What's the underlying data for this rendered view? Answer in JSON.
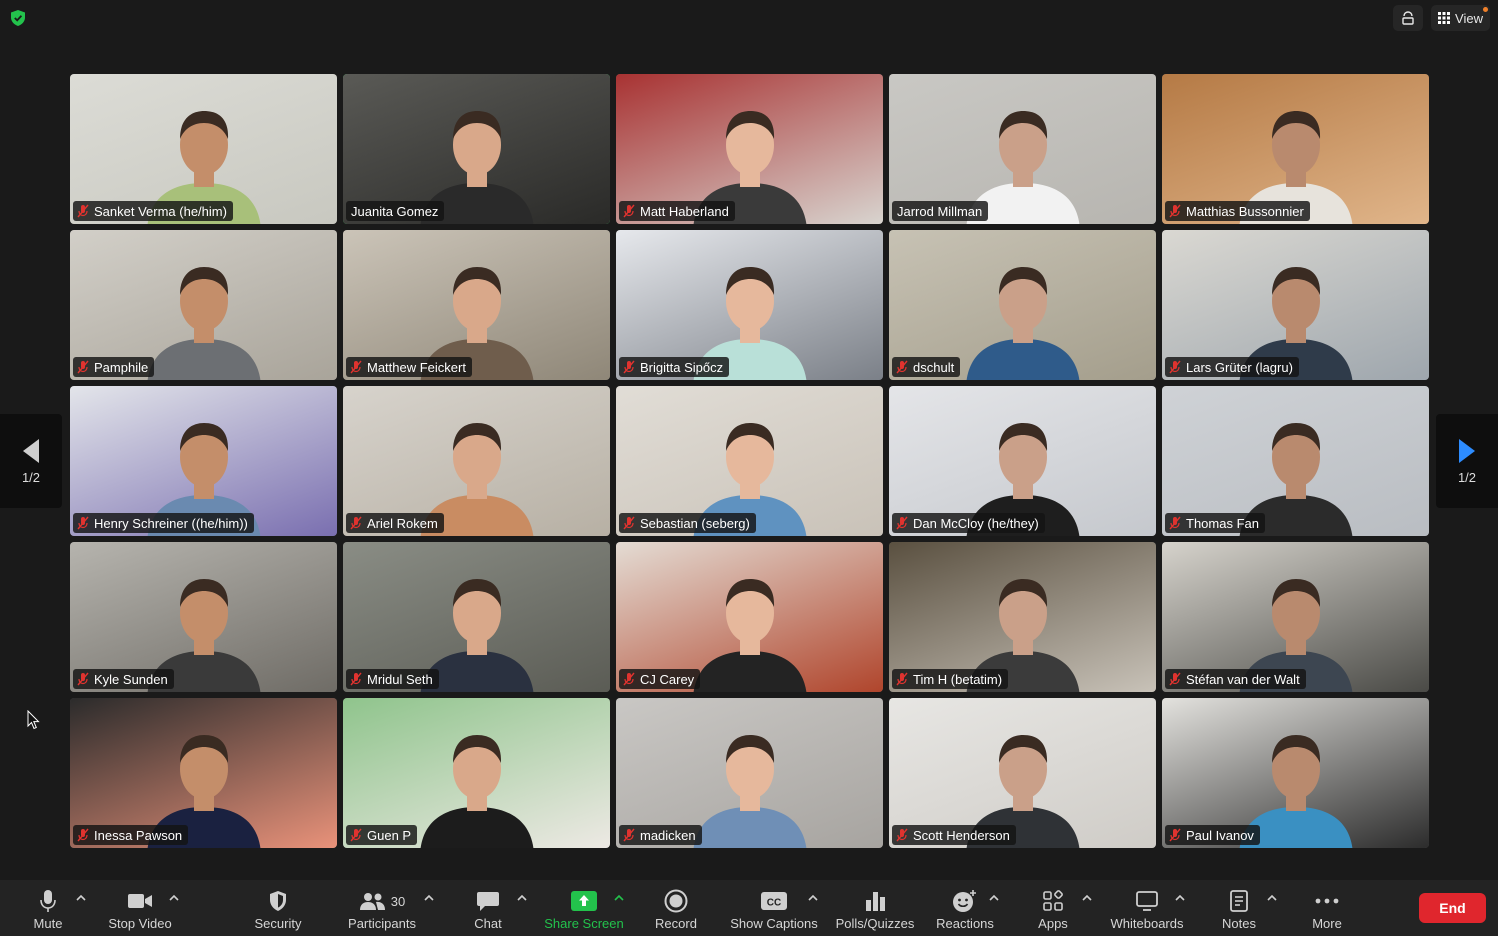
{
  "top": {
    "view_label": "View"
  },
  "colors": {
    "active_border": "#2fd05a",
    "share_green": "#23c24c",
    "end_red": "#e0262d",
    "mute_red": "#e0332f"
  },
  "pager": {
    "left_page": "1/2",
    "right_page": "1/2"
  },
  "participants": [
    {
      "name": "Sanket Verma (he/him)",
      "muted": true
    },
    {
      "name": "Juanita Gomez",
      "muted": false,
      "active": true
    },
    {
      "name": "Matt Haberland",
      "muted": true
    },
    {
      "name": "Jarrod Millman",
      "muted": false
    },
    {
      "name": "Matthias Bussonnier",
      "muted": true
    },
    {
      "name": "Pamphile",
      "muted": true
    },
    {
      "name": "Matthew Feickert",
      "muted": true
    },
    {
      "name": "Brigitta Sipőcz",
      "muted": true
    },
    {
      "name": "dschult",
      "muted": true
    },
    {
      "name": "Lars Grüter (lagru)",
      "muted": true
    },
    {
      "name": "Henry Schreiner ((he/him))",
      "muted": true
    },
    {
      "name": "Ariel Rokem",
      "muted": true
    },
    {
      "name": "Sebastian (seberg)",
      "muted": true
    },
    {
      "name": "Dan McCloy (he/they)",
      "muted": true
    },
    {
      "name": "Thomas Fan",
      "muted": true
    },
    {
      "name": "Kyle Sunden",
      "muted": true
    },
    {
      "name": "Mridul Seth",
      "muted": true
    },
    {
      "name": "CJ Carey",
      "muted": true
    },
    {
      "name": "Tim H (betatim)",
      "muted": true
    },
    {
      "name": "Stéfan van der Walt",
      "muted": true
    },
    {
      "name": "Inessa Pawson",
      "muted": true
    },
    {
      "name": "Guen P",
      "muted": true
    },
    {
      "name": "madicken",
      "muted": true
    },
    {
      "name": "Scott Henderson",
      "muted": true
    },
    {
      "name": "Paul Ivanov",
      "muted": true
    }
  ],
  "toolbar": {
    "mute": "Mute",
    "stop_video": "Stop Video",
    "security": "Security",
    "participants": "Participants",
    "participants_count": "30",
    "chat": "Chat",
    "share_screen": "Share Screen",
    "record": "Record",
    "show_captions": "Show Captions",
    "polls": "Polls/Quizzes",
    "reactions": "Reactions",
    "apps": "Apps",
    "whiteboards": "Whiteboards",
    "notes": "Notes",
    "more": "More",
    "end": "End"
  }
}
